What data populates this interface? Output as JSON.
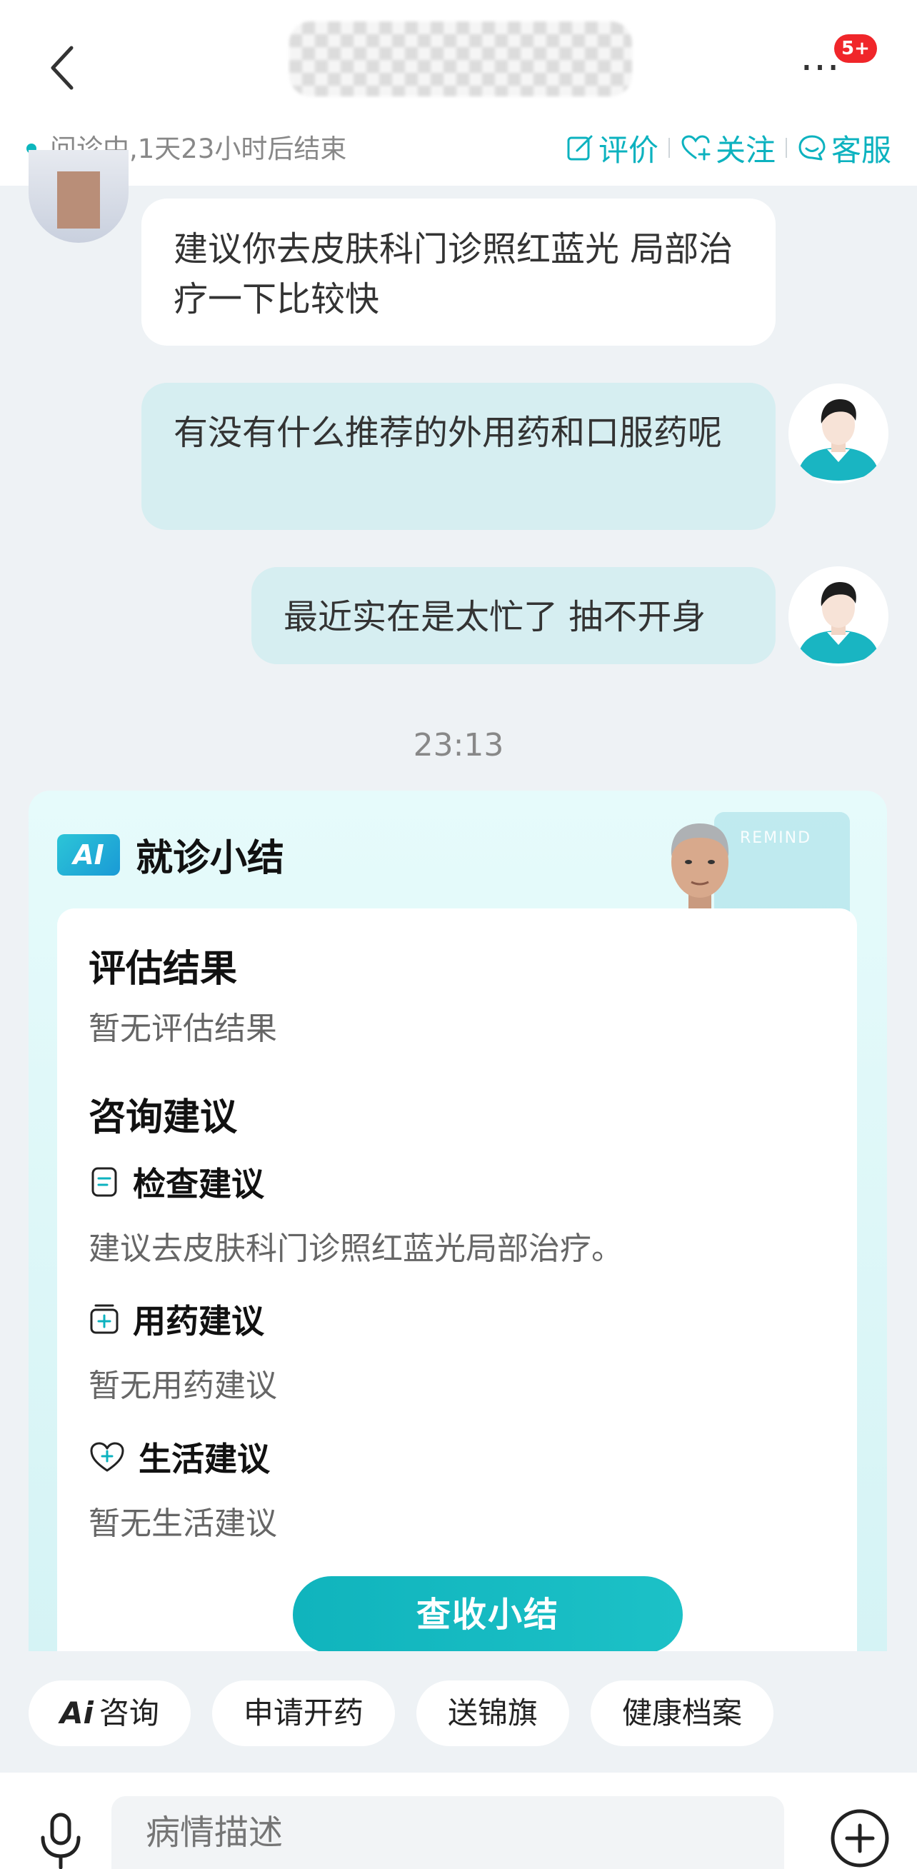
{
  "header": {
    "badge": "5+",
    "more_label": "…"
  },
  "status": {
    "text": "问诊中,1天23小时后结束",
    "actions": [
      {
        "label": "评价",
        "icon": "edit-icon"
      },
      {
        "label": "关注",
        "icon": "heart-plus-icon"
      },
      {
        "label": "客服",
        "icon": "service-icon"
      }
    ]
  },
  "messages": [
    {
      "from": "doctor",
      "text": "建议你去皮肤科门诊照红蓝光 局部治疗一下比较快"
    },
    {
      "from": "user",
      "text": "有没有什么推荐的外用药和口服药呢"
    },
    {
      "from": "user",
      "text": "最近实在是太忙了 抽不开身"
    }
  ],
  "time": "23:13",
  "summary": {
    "ai_badge": "AI",
    "title": "就诊小结",
    "remind_watermark": "REMIND",
    "assessment_heading": "评估结果",
    "assessment_text": "暂无评估结果",
    "advice_heading": "咨询建议",
    "exam_heading": "检查建议",
    "exam_text": "建议去皮肤科门诊照红蓝光局部治疗。",
    "med_heading": "用药建议",
    "med_text": "暂无用药建议",
    "life_heading": "生活建议",
    "life_text": "暂无生活建议",
    "button": "查收小结"
  },
  "quick_actions": [
    {
      "label": "咨询",
      "icon": "ai-icon",
      "prefix": "Ai"
    },
    {
      "label": "申请开药"
    },
    {
      "label": "送锦旗"
    },
    {
      "label": "健康档案"
    }
  ],
  "input": {
    "placeholder": "病情描述"
  },
  "colors": {
    "accent": "#0cb2bf",
    "badge": "#f0262a",
    "user_bubble": "#d6eef1"
  }
}
